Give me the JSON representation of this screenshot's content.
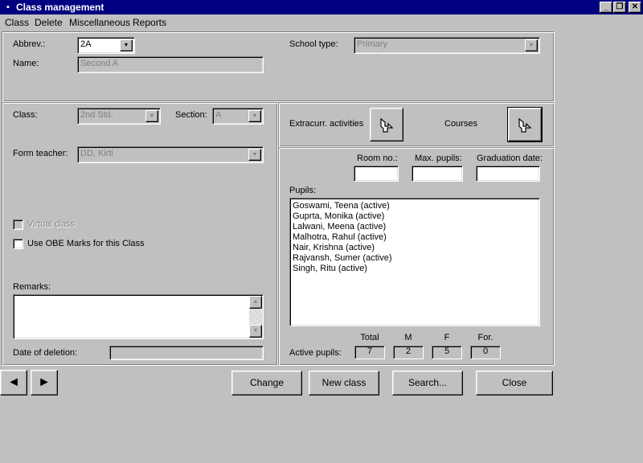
{
  "window": {
    "title": "Class management",
    "minimize": "_",
    "restore": "❐",
    "close": "✕"
  },
  "menu": [
    "Class",
    "Delete",
    "Miscellaneous",
    "Reports"
  ],
  "top": {
    "abbrev_label": "Abbrev.:",
    "abbrev_value": "2A",
    "name_label": "Name:",
    "name_value": "Second A",
    "school_type_label": "School type:",
    "school_type_value": "Primary"
  },
  "left": {
    "class_label": "Class:",
    "class_value": "2nd Std.",
    "section_label": "Section:",
    "section_value": "A",
    "form_teacher_label": "Form teacher:",
    "form_teacher_value": "DD, Kirti",
    "virtual_class_label": "Virtual class",
    "obe_label": "Use OBE Marks for this Class",
    "remarks_label": "Remarks:",
    "remarks_value": "",
    "deletion_label": "Date of deletion:",
    "deletion_value": ""
  },
  "right": {
    "extracurr_label": "Extracurr. activities",
    "courses_label": "Courses",
    "room_label": "Room no.:",
    "room_value": "",
    "max_pupils_label": "Max. pupils:",
    "max_pupils_value": "",
    "graduation_label": "Graduation date:",
    "graduation_value": "",
    "pupils_label": "Pupils:",
    "pupils": [
      "Goswami, Teena (active)",
      "Guprta, Monika (active)",
      "Lalwani, Meena (active)",
      "Malhotra, Rahul (active)",
      "Nair, Krishna (active)",
      "Rajvansh, Sumer (active)",
      "Singh, Ritu (active)"
    ],
    "active_pupils_label": "Active pupils:",
    "counts": {
      "total_label": "Total",
      "total": "7",
      "m_label": "M",
      "m": "2",
      "f_label": "F",
      "f": "5",
      "for_label": "For.",
      "for": "0"
    }
  },
  "buttons": {
    "prev": "◄",
    "next": "►",
    "change": "Change",
    "new_class": "New class",
    "search": "Search...",
    "close": "Close"
  },
  "icons": {
    "app": "app-icon",
    "extracurr": "arrow-pointer-icon",
    "courses": "arrow-pointer-icon"
  }
}
